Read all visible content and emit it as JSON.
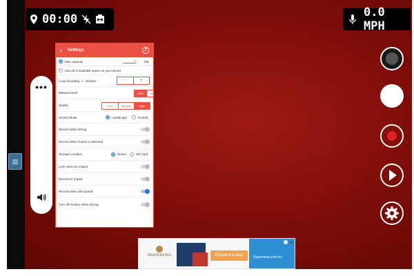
{
  "hud_left": {
    "time": "00:00",
    "icons": [
      "location-pin-icon",
      "flash-off-icon",
      "resolution-icon"
    ]
  },
  "hud_right": {
    "speed": "0.0 MPH",
    "icons": [
      "microphone-icon"
    ]
  },
  "side_pill": {
    "icons": [
      "more-icon",
      "volume-icon"
    ]
  },
  "left_chip": {
    "icon": "sd-card-icon"
  },
  "settings": {
    "title": "Settings",
    "max_capacity": {
      "label": "Max capacity",
      "value": "0",
      "unit": "GB"
    },
    "use_all_space": "Use all of available space on your device",
    "loop_recording": {
      "label": "Loop recording",
      "value": "3",
      "unit": "minutes",
      "minus": "-",
      "plus": "+"
    },
    "measurement": {
      "label": "Measurement",
      "options": [
        "MPH",
        "km/h"
      ],
      "selected": "MPH"
    },
    "quality": {
      "label": "Quality",
      "options": [
        "Low",
        "Medium",
        "High"
      ],
      "selected": "High"
    },
    "screen_mode": {
      "label": "Screen Mode",
      "options": [
        "Landscape",
        "Portrait"
      ],
      "selected": "Landscape"
    },
    "record_while_driving": {
      "label": "Record while driving",
      "on": false
    },
    "record_motion": {
      "label": "Record when motion is detected",
      "on": false
    },
    "storage_location": {
      "label": "Storage Location",
      "options": [
        "Device",
        "SD Card"
      ],
      "selected": "Device"
    },
    "lock_video_impact": {
      "label": "Lock video on impact",
      "on": false
    },
    "record_on_impact": {
      "label": "Record on impact",
      "on": false
    },
    "record_with_speed": {
      "label": "Record video with speed",
      "on": true
    },
    "turn_off_monitor": {
      "label": "Turn off monitor while driving",
      "on": false
    }
  },
  "right_controls": {
    "icons": [
      "camera-switch-icon",
      "snapshot-icon",
      "record-icon",
      "play-icon",
      "gear-icon"
    ]
  },
  "ad": {
    "logo": "TRAVERTINO",
    "cta": "Encuentra aquí",
    "brand": "Superama.com.mx"
  },
  "colors": {
    "accent": "#ea5143",
    "background": "#7a0c08",
    "toggle_on": "#2a72d8"
  }
}
